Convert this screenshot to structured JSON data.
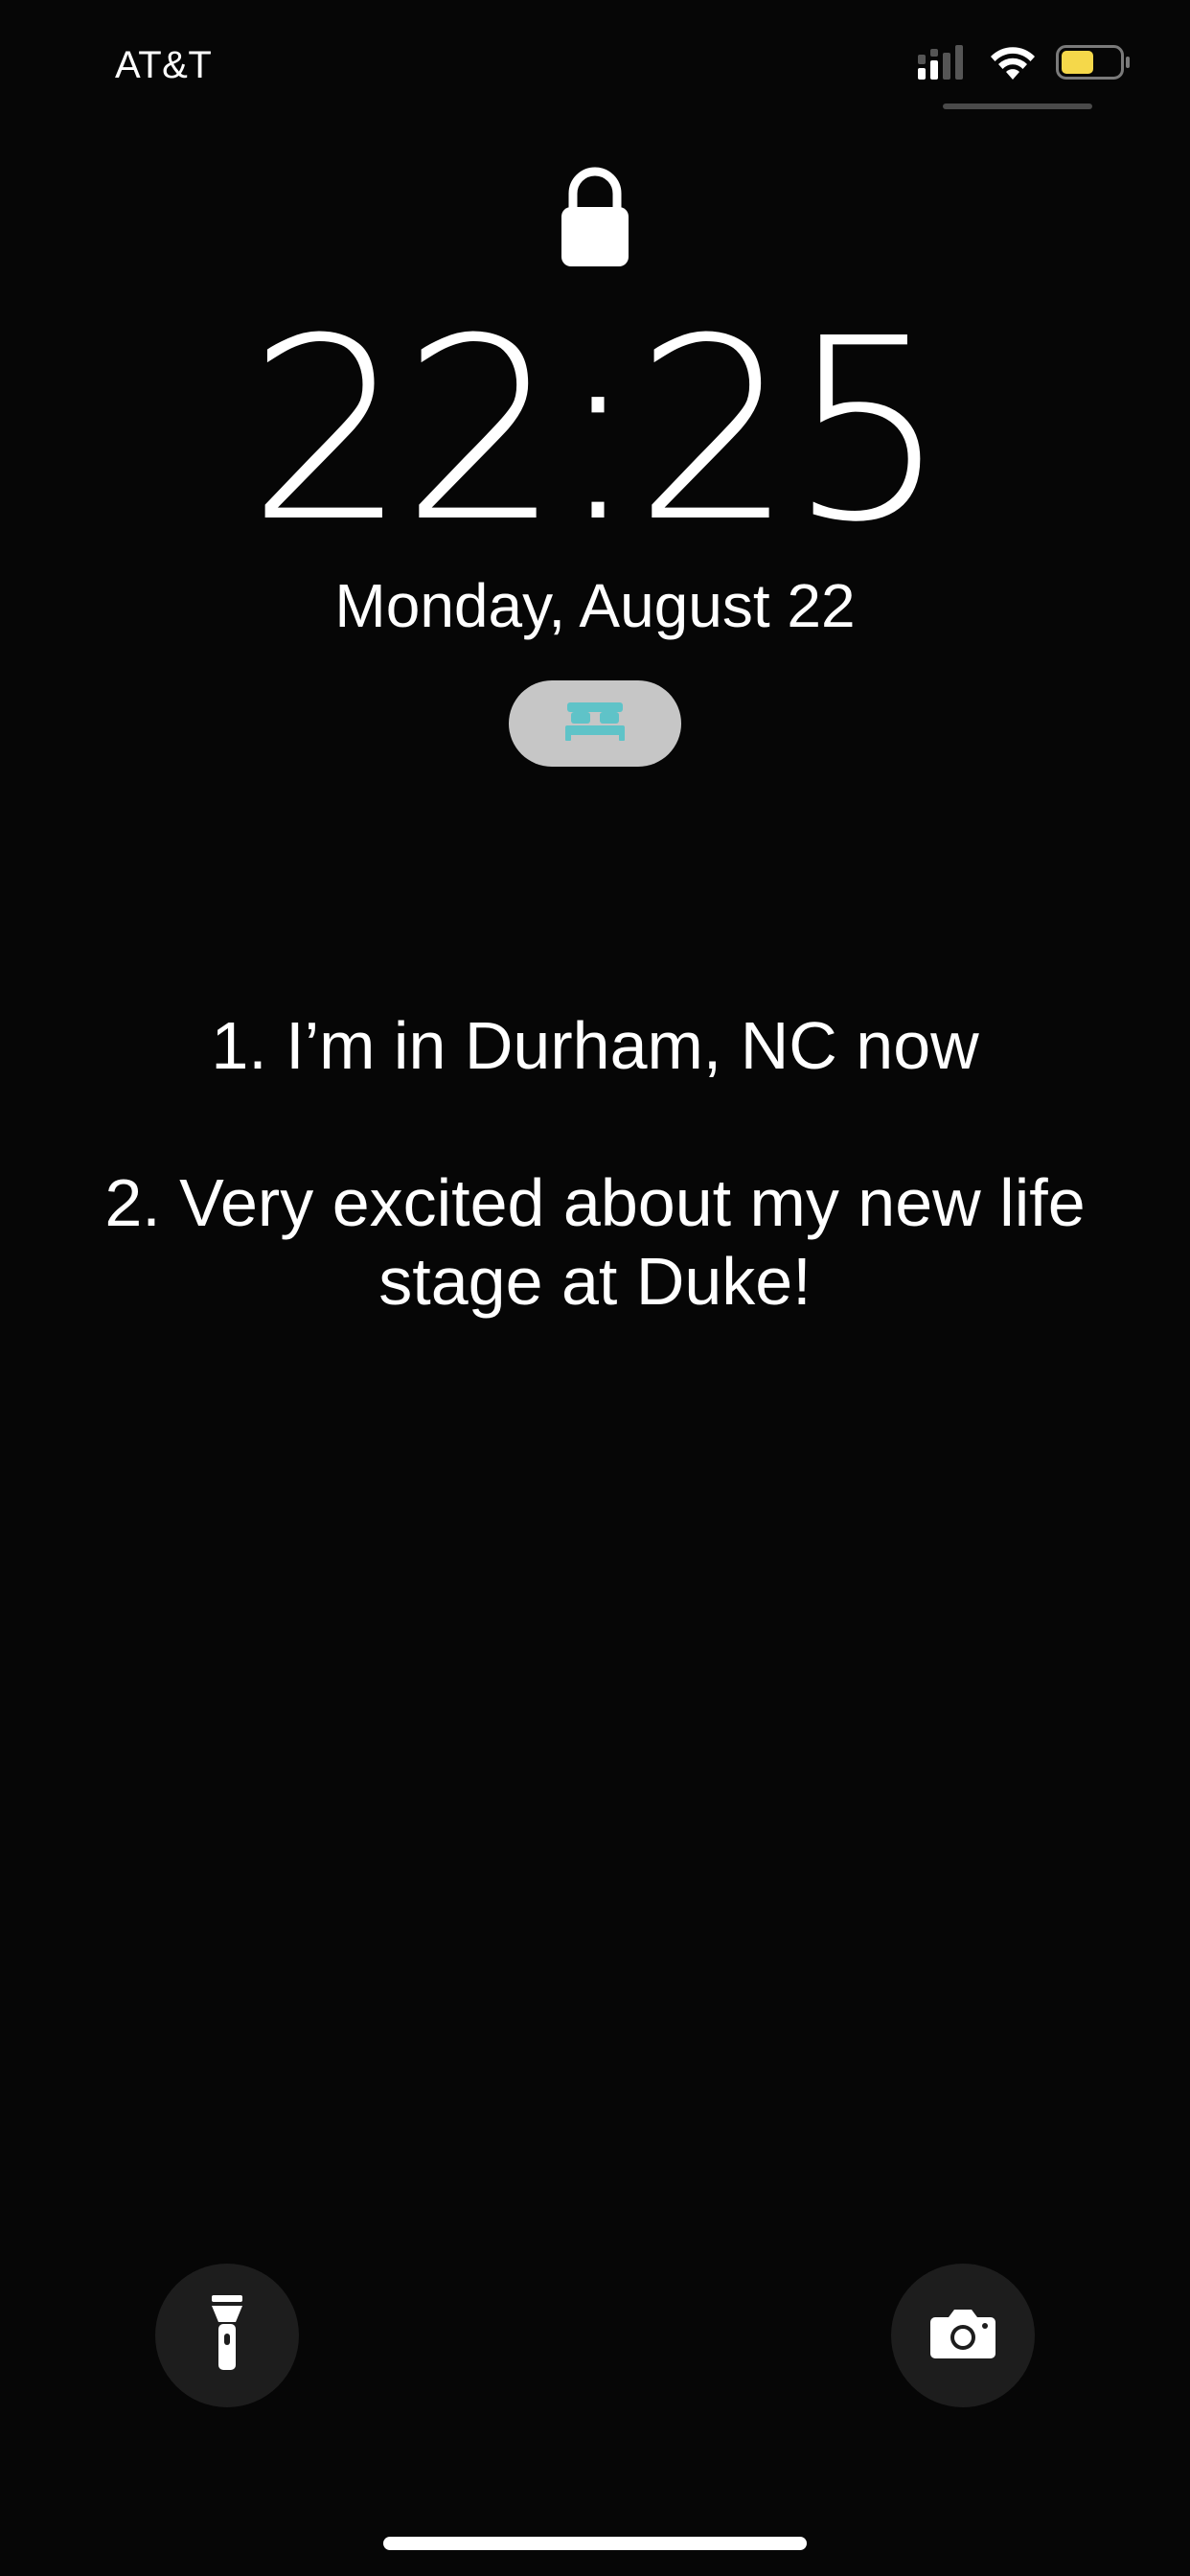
{
  "status_bar": {
    "carrier": "AT&T",
    "signal_icon": "cellular-signal-icon",
    "wifi_icon": "wifi-icon",
    "battery_icon": "battery-icon",
    "battery_level": 0.55,
    "battery_color": "#f5d84a"
  },
  "lock_screen": {
    "lock_icon": "lock-icon",
    "time": "22:25",
    "date": "Monday, August 22",
    "sleep_focus_icon": "bed-icon",
    "sleep_focus_color": "#5fc3c8",
    "messages": [
      "1. I’m in Durham, NC now",
      "2. Very excited about my new life stage at Duke!"
    ]
  },
  "quick_actions": {
    "flashlight_icon": "flashlight-icon",
    "camera_icon": "camera-icon"
  }
}
